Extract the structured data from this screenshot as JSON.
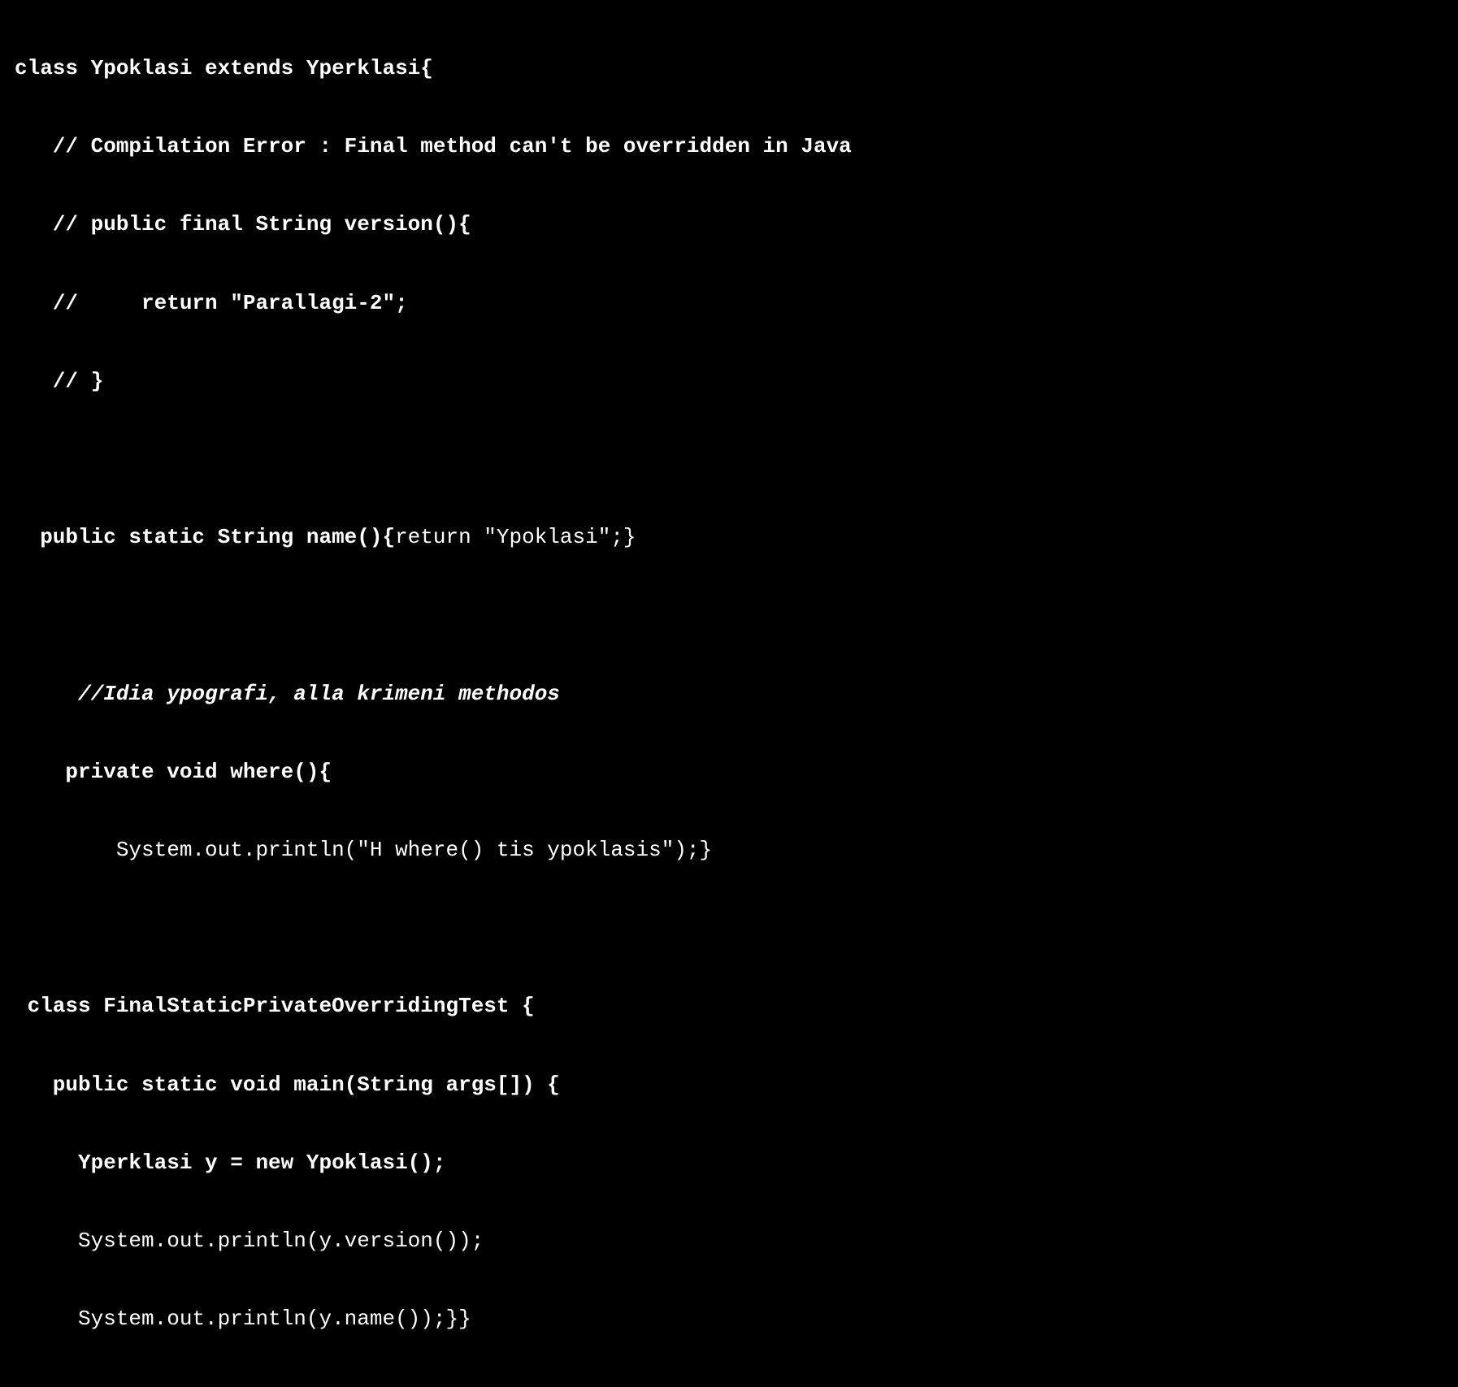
{
  "code": {
    "l1": "class Ypoklasi extends Yperklasi{",
    "l2": "   // Compilation Error : Final method can't be overridden in Java",
    "l3": "   // public final String version(){",
    "l4": "   //     return \"Parallagi-2\";",
    "l5": "   // }",
    "l6_a": "  public static String name(){",
    "l6_b": "return \"Ypoklasi\";}",
    "l7": "     //Idia ypografi, alla krimeni methodos",
    "l8": "    private void where(){",
    "l9": "        System.out.println(\"H where() tis ypoklasis\");}",
    "l10": " class FinalStaticPrivateOverridingTest {",
    "l11": "   public static void main(String args[]) {",
    "l12": "     Yperklasi y = new Ypoklasi();",
    "l13": "     System.out.println(y.version());",
    "l14": "     System.out.println(y.name());}}"
  }
}
